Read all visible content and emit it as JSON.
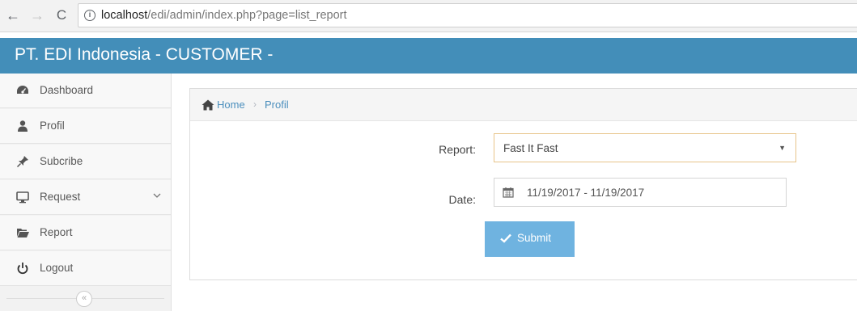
{
  "browser": {
    "url_host": "localhost",
    "url_path": "/edi/admin/index.php?page=list_report",
    "info_symbol": "i"
  },
  "header": {
    "title": "PT. EDI Indonesia - CUSTOMER -",
    "bg_color": "#438eb9"
  },
  "sidebar": {
    "items": [
      {
        "label": "Dashboard",
        "icon": "dashboard-icon"
      },
      {
        "label": "Profil",
        "icon": "user-icon"
      },
      {
        "label": "Subcribe",
        "icon": "pin-icon"
      },
      {
        "label": "Request",
        "icon": "desktop-icon"
      },
      {
        "label": "Report",
        "icon": "folder-open-icon"
      },
      {
        "label": "Logout",
        "icon": "power-icon"
      }
    ],
    "collapse_symbol": "«"
  },
  "breadcrumb": {
    "home": "Home",
    "separator": "›",
    "current": "Profil",
    "link_color": "#4c8fbd"
  },
  "form": {
    "report_label": "Report:",
    "report_value": "Fast It Fast",
    "date_label": "Date:",
    "date_value": "11/19/2017 - 11/19/2017",
    "submit_label": "Submit",
    "submit_color": "#6fb3e0"
  }
}
